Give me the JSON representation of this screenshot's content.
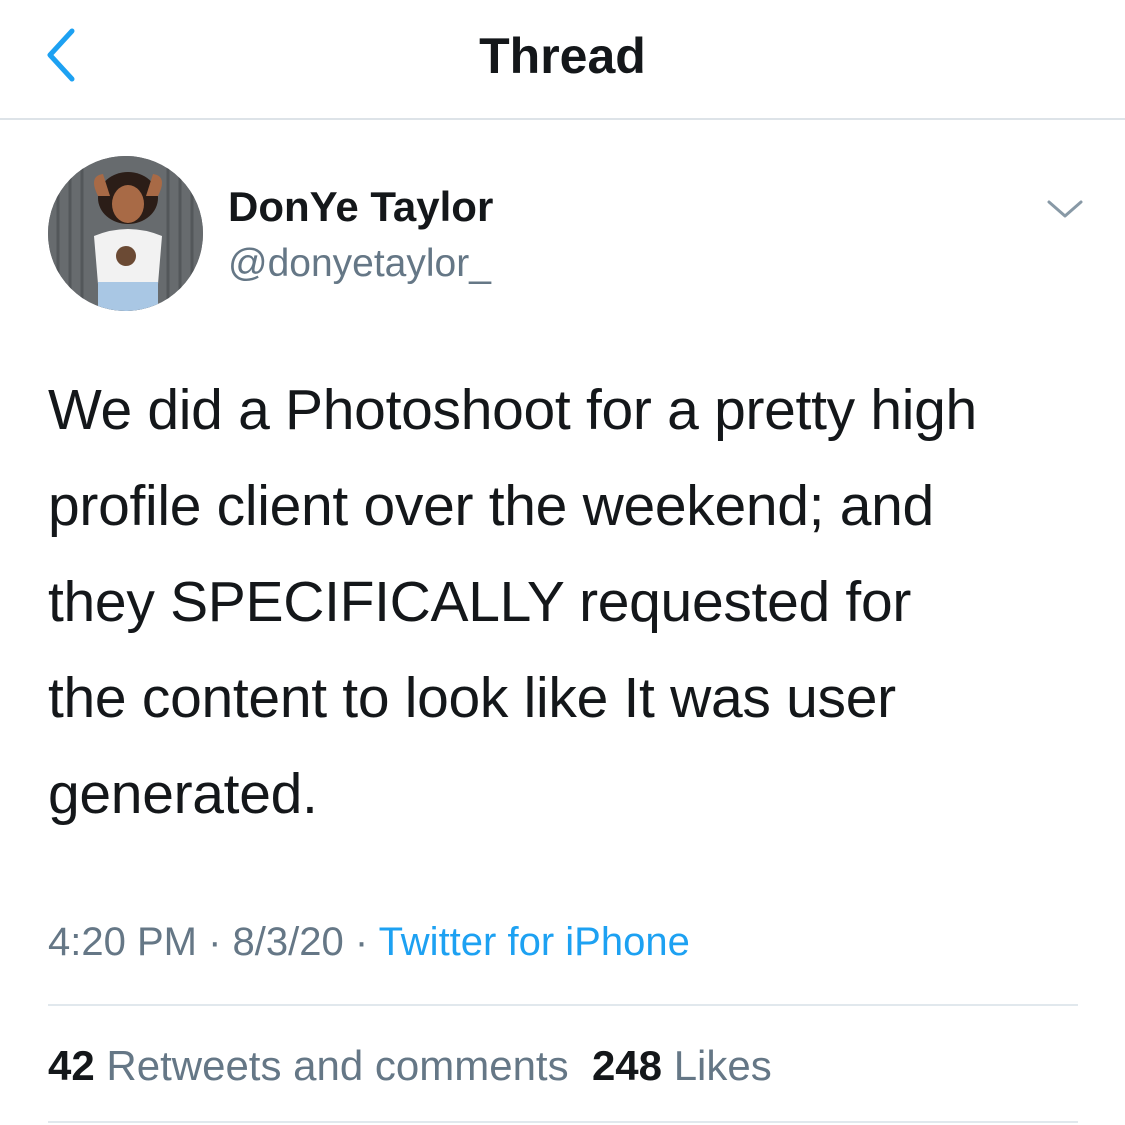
{
  "header": {
    "title": "Thread",
    "back_icon": "chevron-left-icon",
    "accent_color": "#1da1f2"
  },
  "tweet": {
    "author_name": "DonYe Taylor",
    "author_handle": "@donyetaylor_",
    "menu_icon": "chevron-down-icon",
    "text_lines": [
      "We did a Photoshoot for a pretty high",
      "profile client over the weekend; and",
      "they SPECIFICALLY requested for",
      "the content to look like It was user",
      "generated."
    ],
    "time": "4:20 PM",
    "separator": " · ",
    "date": "8/3/20",
    "source": "Twitter for iPhone",
    "retweets_count": "42",
    "retweets_label": "Retweets and comments",
    "likes_count": "248",
    "likes_label": "Likes"
  },
  "colors": {
    "text_primary": "#14171a",
    "text_secondary": "#657786",
    "link": "#1da1f2",
    "divider": "#e1e8ed"
  }
}
